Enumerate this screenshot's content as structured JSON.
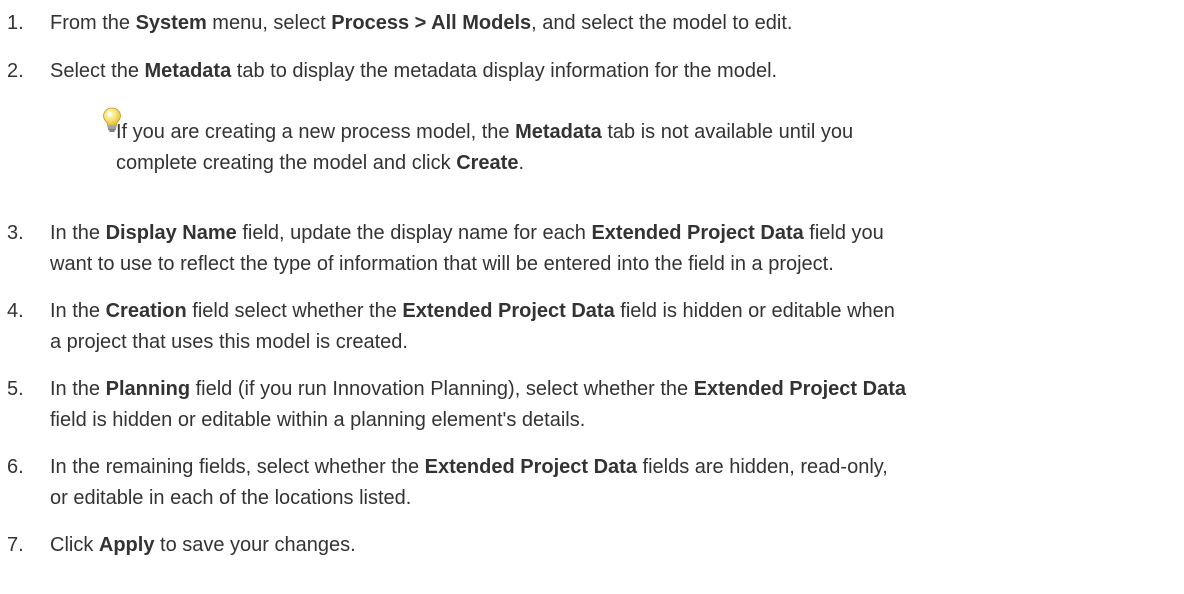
{
  "steps": [
    {
      "number": "1.",
      "parts": [
        {
          "t": "From the "
        },
        {
          "b": "System"
        },
        {
          "t": " menu, select "
        },
        {
          "b": "Process > All Models"
        },
        {
          "t": ", and select the model to edit."
        }
      ]
    },
    {
      "number": "2.",
      "parts": [
        {
          "t": "Select the "
        },
        {
          "b": "Metadata"
        },
        {
          "t": " tab to display the metadata display information for the model."
        }
      ]
    },
    {
      "number": "3.",
      "parts": [
        {
          "t": "In the "
        },
        {
          "b": "Display Name"
        },
        {
          "t": " field, update the display name for each "
        },
        {
          "b": "Extended Project Data"
        },
        {
          "t": " field you"
        },
        {
          "br": true
        },
        {
          "t": "want to use to reflect the type of information that will be entered into the field in a project."
        }
      ]
    },
    {
      "number": "4.",
      "parts": [
        {
          "t": "In the "
        },
        {
          "b": "Creation"
        },
        {
          "t": " field select whether the "
        },
        {
          "b": "Extended Project Data"
        },
        {
          "t": " field is hidden or editable when"
        },
        {
          "br": true
        },
        {
          "t": "a project that uses this model is created."
        }
      ]
    },
    {
      "number": "5.",
      "parts": [
        {
          "t": "In the "
        },
        {
          "b": "Planning"
        },
        {
          "t": " field (if you run Innovation Planning), select whether the "
        },
        {
          "b": "Extended Project Data"
        },
        {
          "br": true
        },
        {
          "t": "field is hidden or editable within a planning element's details."
        }
      ]
    },
    {
      "number": "6.",
      "parts": [
        {
          "t": "In the remaining fields, select whether the "
        },
        {
          "b": "Extended Project Data"
        },
        {
          "t": " fields are hidden, read-only,"
        },
        {
          "br": true
        },
        {
          "t": "or editable in each of the locations listed."
        }
      ]
    },
    {
      "number": "7.",
      "parts": [
        {
          "t": "Click "
        },
        {
          "b": "Apply"
        },
        {
          "t": " to save your changes."
        }
      ]
    }
  ],
  "tip": {
    "icon": "lightbulb-icon",
    "parts": [
      {
        "t": "If you are creating a new process model, the "
      },
      {
        "b": "Metadata"
      },
      {
        "t": " tab is not available until you"
      },
      {
        "br": true
      },
      {
        "t": "complete creating the model and click "
      },
      {
        "b": "Create"
      },
      {
        "t": "."
      }
    ]
  }
}
